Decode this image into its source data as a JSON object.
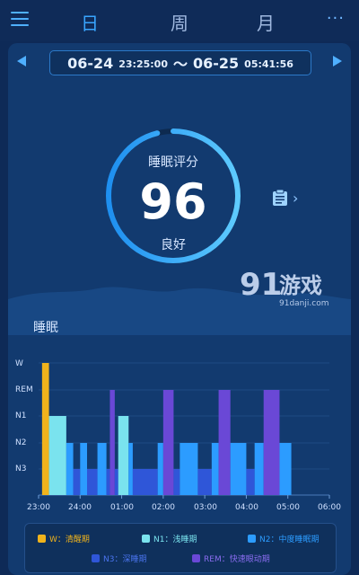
{
  "header": {
    "tabs": [
      {
        "label": "日",
        "active": true
      },
      {
        "label": "周",
        "active": false
      },
      {
        "label": "月",
        "active": false
      }
    ],
    "more": "···"
  },
  "date_range": {
    "start_date": "06-24",
    "start_time": "23:25:00",
    "separator": "〜",
    "end_date": "06-25",
    "end_time": "05:41:56"
  },
  "score": {
    "label": "睡眠评分",
    "value": "96",
    "grade": "良好",
    "fraction": 0.96
  },
  "watermark": {
    "brand": "91游戏",
    "site": "91danji.com"
  },
  "section": {
    "title": "睡眠"
  },
  "chart_data": {
    "type": "bar",
    "stages": [
      "W",
      "REM",
      "N1",
      "N2",
      "N3"
    ],
    "x_ticks": [
      "23:00",
      "24:00",
      "01:00",
      "02:00",
      "03:00",
      "04:00",
      "05:00",
      "06:00"
    ],
    "x_start": "23:00",
    "x_end": "06:00",
    "segments": [
      {
        "stage": "W",
        "start": "23:05",
        "end": "23:15"
      },
      {
        "stage": "N1",
        "start": "23:15",
        "end": "23:40"
      },
      {
        "stage": "N2",
        "start": "23:40",
        "end": "23:50"
      },
      {
        "stage": "N3",
        "start": "23:50",
        "end": "24:00"
      },
      {
        "stage": "N2",
        "start": "24:00",
        "end": "24:10"
      },
      {
        "stage": "N3",
        "start": "24:10",
        "end": "24:25"
      },
      {
        "stage": "N2",
        "start": "24:25",
        "end": "24:38"
      },
      {
        "stage": "N3",
        "start": "24:38",
        "end": "24:43"
      },
      {
        "stage": "REM",
        "start": "24:43",
        "end": "24:50"
      },
      {
        "stage": "N3",
        "start": "24:50",
        "end": "24:55"
      },
      {
        "stage": "N1",
        "start": "24:55",
        "end": "25:10"
      },
      {
        "stage": "N2",
        "start": "25:10",
        "end": "25:16"
      },
      {
        "stage": "N3",
        "start": "25:16",
        "end": "25:52"
      },
      {
        "stage": "N2",
        "start": "25:52",
        "end": "26:00"
      },
      {
        "stage": "REM",
        "start": "26:00",
        "end": "26:15"
      },
      {
        "stage": "N3",
        "start": "26:15",
        "end": "26:24"
      },
      {
        "stage": "N2",
        "start": "26:24",
        "end": "26:50"
      },
      {
        "stage": "N3",
        "start": "26:50",
        "end": "27:10"
      },
      {
        "stage": "N2",
        "start": "27:10",
        "end": "27:20"
      },
      {
        "stage": "REM",
        "start": "27:20",
        "end": "27:37"
      },
      {
        "stage": "N2",
        "start": "27:37",
        "end": "28:00"
      },
      {
        "stage": "N3",
        "start": "28:00",
        "end": "28:12"
      },
      {
        "stage": "N2",
        "start": "28:12",
        "end": "28:25"
      },
      {
        "stage": "REM",
        "start": "28:25",
        "end": "28:48"
      },
      {
        "stage": "N2",
        "start": "28:48",
        "end": "29:05"
      }
    ]
  },
  "legend": [
    {
      "stage": "W",
      "label": "W：清醒期",
      "color": "#f0b31c"
    },
    {
      "stage": "N1",
      "label": "N1：浅睡期",
      "color": "#7ae3ee"
    },
    {
      "stage": "N2",
      "label": "N2：中度睡眠期",
      "color": "#2c9cff"
    },
    {
      "stage": "N3",
      "label": "N3：深睡期",
      "color": "#2f56d8"
    },
    {
      "stage": "REM",
      "label": "REM：快速眼动期",
      "color": "#6a48d6"
    }
  ],
  "colors": {
    "accent": "#39a6ff",
    "background": "#0e2a57",
    "card": "#123a6f"
  }
}
